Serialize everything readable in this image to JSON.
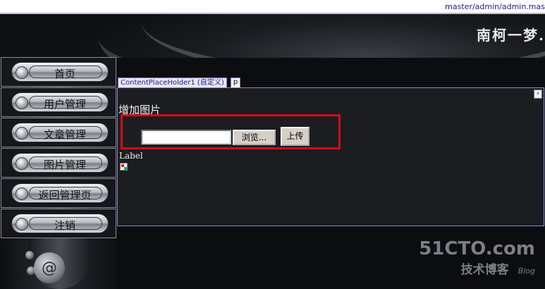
{
  "path_bar": {
    "path": "master/admin/admin.mas"
  },
  "header": {
    "title": "南柯一梦."
  },
  "nav": {
    "items": [
      {
        "label": "首页"
      },
      {
        "label": "用户管理"
      },
      {
        "label": "文章管理"
      },
      {
        "label": "图片管理"
      },
      {
        "label": "返回管理页"
      },
      {
        "label": "注销"
      }
    ]
  },
  "designer": {
    "placeholder_tab": "ContentPlaceHolder1 (自定义)",
    "p_tab": "p",
    "smart_tag": "›"
  },
  "content": {
    "heading": "增加图片",
    "file_input_value": "",
    "browse_label": "浏览...",
    "upload_label": "上传",
    "label_text": "Label"
  },
  "watermark": {
    "line1": "51CTO.com",
    "line2": "技术博客",
    "line3": "Blog"
  },
  "colors": {
    "highlight_border": "#d40d12",
    "panel_border": "#8f86d8",
    "panel_bg": "#1b1d21"
  },
  "icons": [
    "at-sign-icon",
    "broken-image-icon",
    "smart-tag-arrow-icon"
  ]
}
